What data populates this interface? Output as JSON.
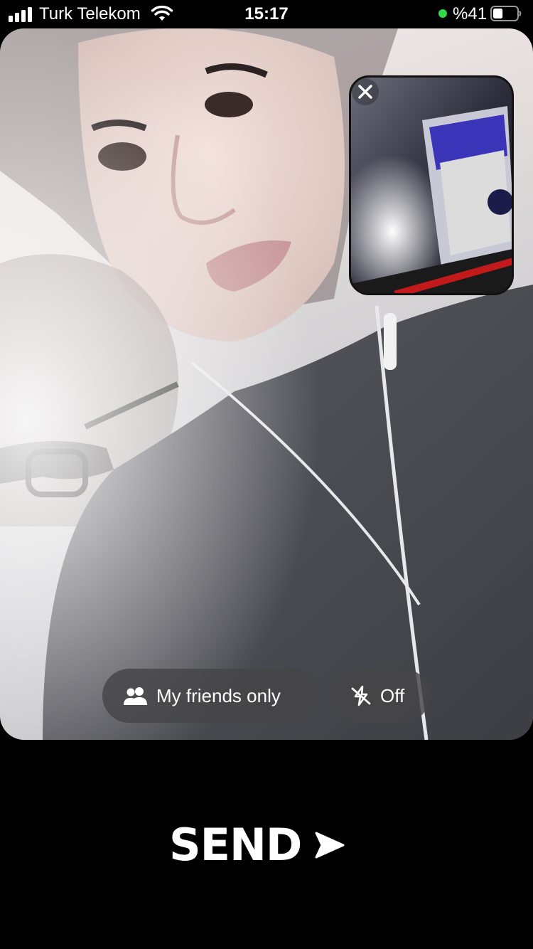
{
  "status_bar": {
    "carrier": "Turk Telekom",
    "time": "15:17",
    "battery_percent": "%41",
    "battery_level": 0.41,
    "signal_icon": "signal-bars-icon",
    "wifi_icon": "wifi-icon",
    "battery_icon": "battery-icon",
    "privacy_indicator_color": "#32d74b"
  },
  "pip": {
    "close_icon": "close-icon"
  },
  "options": {
    "audience_label": "My friends only",
    "audience_icon": "friends-icon",
    "flash_label": "Off",
    "flash_icon": "flash-off-icon"
  },
  "send": {
    "label": "SEND",
    "icon": "send-arrow-icon"
  },
  "colors": {
    "background": "#000000",
    "pill_background": "#464648",
    "text": "#ffffff"
  }
}
